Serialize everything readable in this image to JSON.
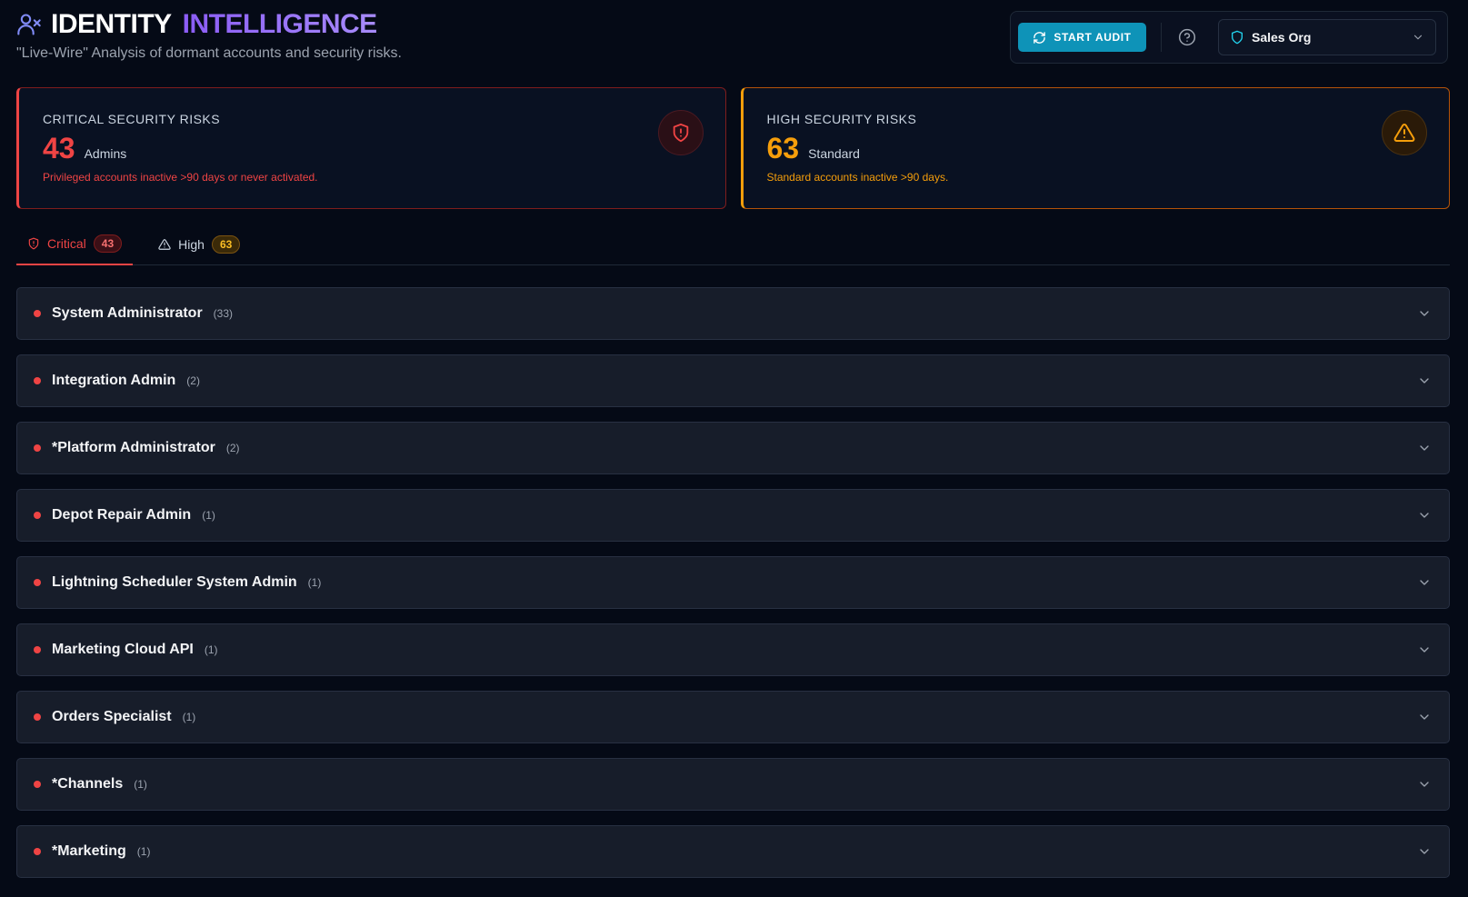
{
  "header": {
    "title_main": "IDENTITY",
    "title_accent": "INTELLIGENCE",
    "subtitle": "\"Live-Wire\" Analysis of dormant accounts and security risks."
  },
  "controls": {
    "audit_label": "START AUDIT",
    "org_selected": "Sales Org"
  },
  "cards": {
    "critical": {
      "label": "CRITICAL SECURITY RISKS",
      "value": "43",
      "unit": "Admins",
      "description": "Privileged accounts inactive >90 days or never activated."
    },
    "high": {
      "label": "HIGH SECURITY RISKS",
      "value": "63",
      "unit": "Standard",
      "description": "Standard accounts inactive >90 days."
    }
  },
  "tabs": [
    {
      "label": "Critical",
      "count": "43"
    },
    {
      "label": "High",
      "count": "63"
    }
  ],
  "groups": [
    {
      "name": "System Administrator",
      "count": "(33)"
    },
    {
      "name": "Integration Admin",
      "count": "(2)"
    },
    {
      "name": "*Platform Administrator",
      "count": "(2)"
    },
    {
      "name": "Depot Repair Admin",
      "count": "(1)"
    },
    {
      "name": "Lightning Scheduler System Admin",
      "count": "(1)"
    },
    {
      "name": "Marketing Cloud API",
      "count": "(1)"
    },
    {
      "name": "Orders Specialist",
      "count": "(1)"
    },
    {
      "name": "*Channels",
      "count": "(1)"
    },
    {
      "name": "*Marketing",
      "count": "(1)"
    }
  ],
  "colors": {
    "critical": "#ef4444",
    "high": "#f59e0b",
    "accent": "#8b5cf6",
    "audit_button": "#0e93b8"
  },
  "icons": {
    "title": "user-x-icon",
    "audit": "refresh-icon",
    "help": "help-circle-icon",
    "org": "shield-icon",
    "critical_badge": "shield-alert-icon",
    "high_badge": "alert-triangle-icon",
    "row_expand": "chevron-down-icon"
  }
}
